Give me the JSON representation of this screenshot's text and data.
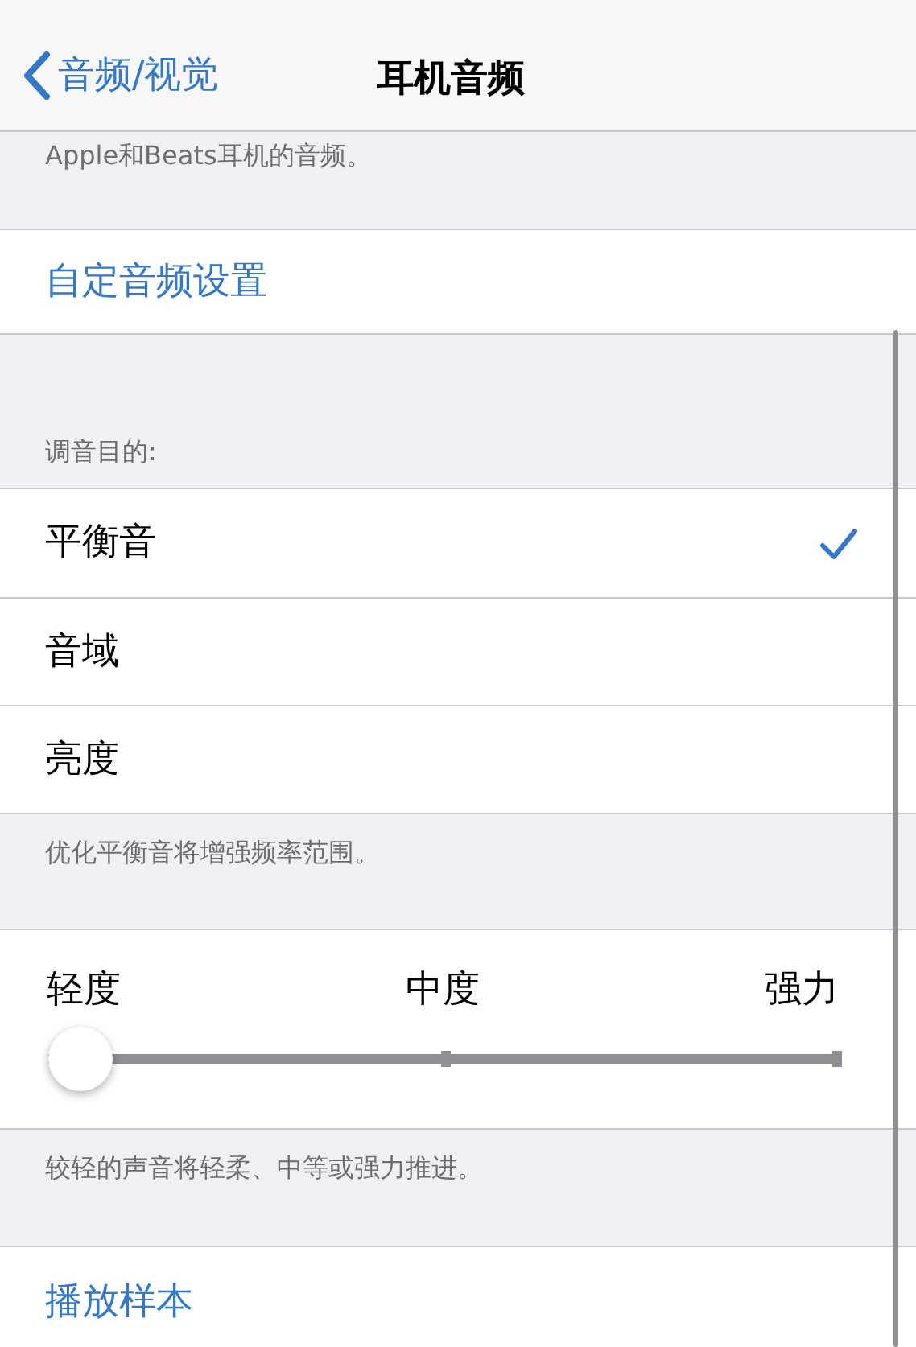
{
  "nav": {
    "back": "音频/视觉",
    "title": "耳机音频"
  },
  "intro_footer": "Apple和Beats耳机的音频。",
  "custom_link": "自定音频设置",
  "tune": {
    "header": "调音目的:",
    "options": [
      {
        "label": "平衡音",
        "selected": true
      },
      {
        "label": "音域",
        "selected": false
      },
      {
        "label": "亮度",
        "selected": false
      }
    ],
    "footer": "优化平衡音将增强频率范围。"
  },
  "strength": {
    "labels": [
      "轻度",
      "中度",
      "强力"
    ],
    "level": 0,
    "footer": "较轻的声音将轻柔、中等或强力推进。"
  },
  "play_link": "播放样本"
}
